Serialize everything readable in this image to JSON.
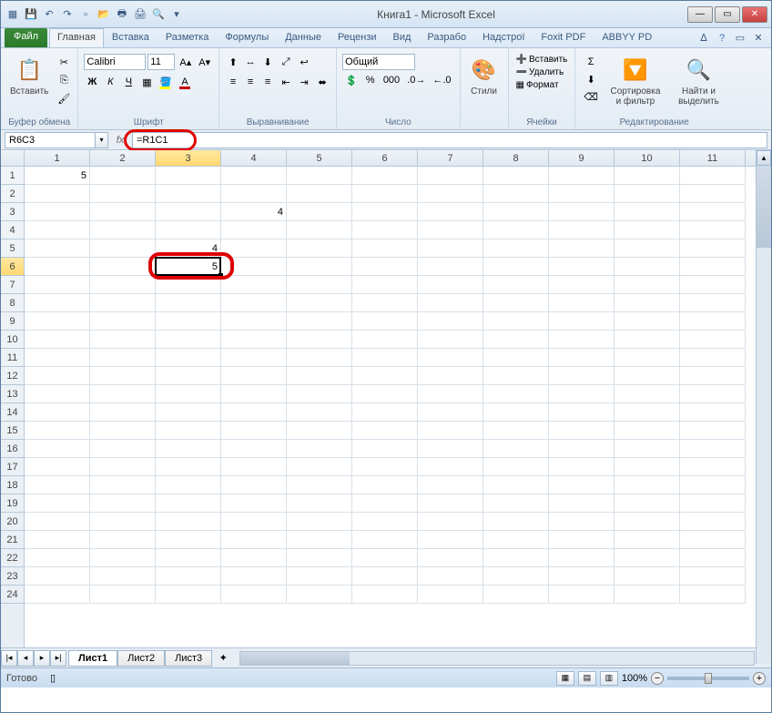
{
  "window": {
    "title": "Книга1  -  Microsoft Excel"
  },
  "qat_icons": [
    "excel",
    "save",
    "undo",
    "redo",
    "new",
    "open",
    "print",
    "quickprint",
    "preview"
  ],
  "tabs": {
    "file": "Файл",
    "items": [
      "Главная",
      "Вставка",
      "Разметка",
      "Формулы",
      "Данные",
      "Рецензи",
      "Вид",
      "Разрабо",
      "Надстрої",
      "Foxit PDF",
      "ABBYY PD"
    ],
    "active_index": 0
  },
  "ribbon": {
    "clipboard": {
      "label": "Буфер обмена",
      "paste": "Вставить"
    },
    "font": {
      "label": "Шрифт",
      "name": "Calibri",
      "size": "11"
    },
    "alignment": {
      "label": "Выравнивание"
    },
    "number": {
      "label": "Число",
      "format": "Общий"
    },
    "styles": {
      "label": "Стили",
      "btn": "Стили"
    },
    "cells": {
      "label": "Ячейки",
      "insert": "Вставить",
      "delete": "Удалить",
      "format": "Формат"
    },
    "editing": {
      "label": "Редактирование",
      "sort": "Сортировка и фильтр",
      "find": "Найти и выделить"
    }
  },
  "formula_bar": {
    "name_box": "R6C3",
    "formula": "=R1C1"
  },
  "columns": [
    "1",
    "2",
    "3",
    "4",
    "5",
    "6",
    "7",
    "8",
    "9",
    "10",
    "11"
  ],
  "rows": [
    "1",
    "2",
    "3",
    "4",
    "5",
    "6",
    "7",
    "8",
    "9",
    "10",
    "11",
    "12",
    "13",
    "14",
    "15",
    "16",
    "17",
    "18",
    "19",
    "20",
    "21",
    "22",
    "23",
    "24"
  ],
  "cell_data": {
    "r1c1": "5",
    "r3c4": "4",
    "r5c3": "4",
    "r6c3": "5"
  },
  "selection": {
    "row": 6,
    "col": 3
  },
  "sheets": {
    "items": [
      "Лист1",
      "Лист2",
      "Лист3"
    ],
    "active_index": 0
  },
  "status": {
    "text": "Готово",
    "zoom": "100%"
  }
}
